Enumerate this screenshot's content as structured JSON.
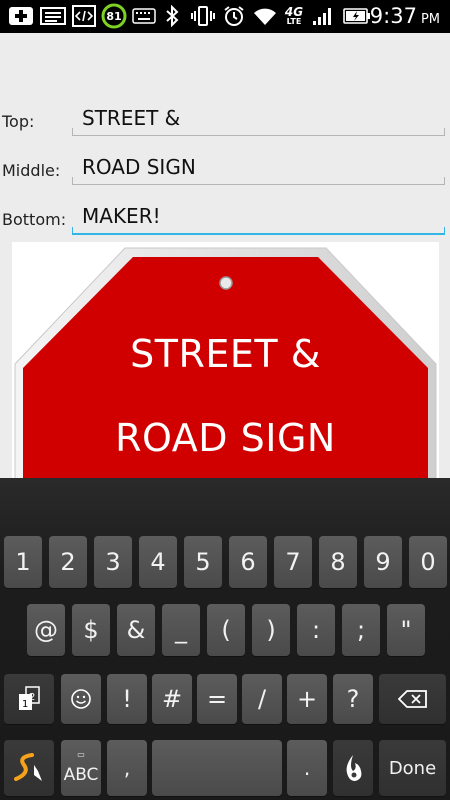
{
  "status_bar": {
    "battery_percent": "81",
    "time": "9:37",
    "ampm": "PM",
    "network": "4G",
    "network_sub": "LTE",
    "icons": [
      "add-icon",
      "image-icon",
      "code-icon",
      "battery-circle-icon",
      "keyboard-icon",
      "bluetooth-icon",
      "vibrate-icon",
      "alarm-icon",
      "wifi-icon",
      "lte-signal-icon",
      "signal-bars-icon",
      "battery-icon"
    ]
  },
  "form": {
    "top": {
      "label": "Top:",
      "value": "STREET &"
    },
    "middle": {
      "label": "Middle:",
      "value": "ROAD SIGN"
    },
    "bottom": {
      "label": "Bottom:",
      "value": "MAKER!"
    }
  },
  "sign": {
    "line1": "STREET &",
    "line2": "ROAD SIGN",
    "color": "#d00000",
    "border_color": "#e8e8e8"
  },
  "keyboard": {
    "row1": [
      "1",
      "2",
      "3",
      "4",
      "5",
      "6",
      "7",
      "8",
      "9",
      "0"
    ],
    "row2": [
      "@",
      "$",
      "&",
      "_",
      "(",
      ")",
      ":",
      ";",
      "\""
    ],
    "row3": [
      "!",
      "#",
      "=",
      "/",
      "+",
      "?"
    ],
    "abc_label": "ABC",
    "comma_label": ",",
    "period_label": ".",
    "done_label": "Done"
  }
}
